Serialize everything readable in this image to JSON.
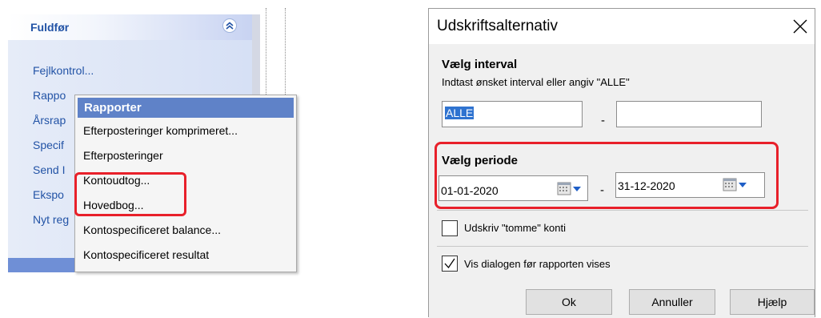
{
  "taskpane": {
    "title": "Fuldfør",
    "links": [
      "Fejlkontrol...",
      "Rappo",
      "Årsrap",
      "Specif",
      "Send I",
      "Ekspo",
      "Nyt reg"
    ]
  },
  "context_menu": {
    "header": "Rapporter",
    "items": [
      "Efterposteringer komprimeret...",
      "Efterposteringer",
      "Kontoudtog...",
      "Hovedbog...",
      "Kontospecificeret balance...",
      "Kontospecificeret resultat"
    ]
  },
  "dialog": {
    "title": "Udskriftsalternativ",
    "interval": {
      "heading": "Vælg interval",
      "instruction": "Indtast ønsket interval eller angiv \"ALLE\"",
      "from_value": "ALLE",
      "to_value": "",
      "separator": "-"
    },
    "period": {
      "heading": "Vælg periode",
      "from_date": "01-01-2020",
      "to_date": "31-12-2020",
      "separator": "-"
    },
    "checkboxes": [
      {
        "label": "Udskriv \"tomme\" konti",
        "checked": false
      },
      {
        "label": "Vis dialogen før rapporten vises",
        "checked": true
      }
    ],
    "buttons": {
      "ok": "Ok",
      "cancel": "Annuller",
      "help": "Hjælp"
    }
  },
  "colors": {
    "highlight": "#e8202a",
    "link_blue": "#2253a6",
    "menu_header": "#5f82c8",
    "selection": "#2f73d0"
  }
}
